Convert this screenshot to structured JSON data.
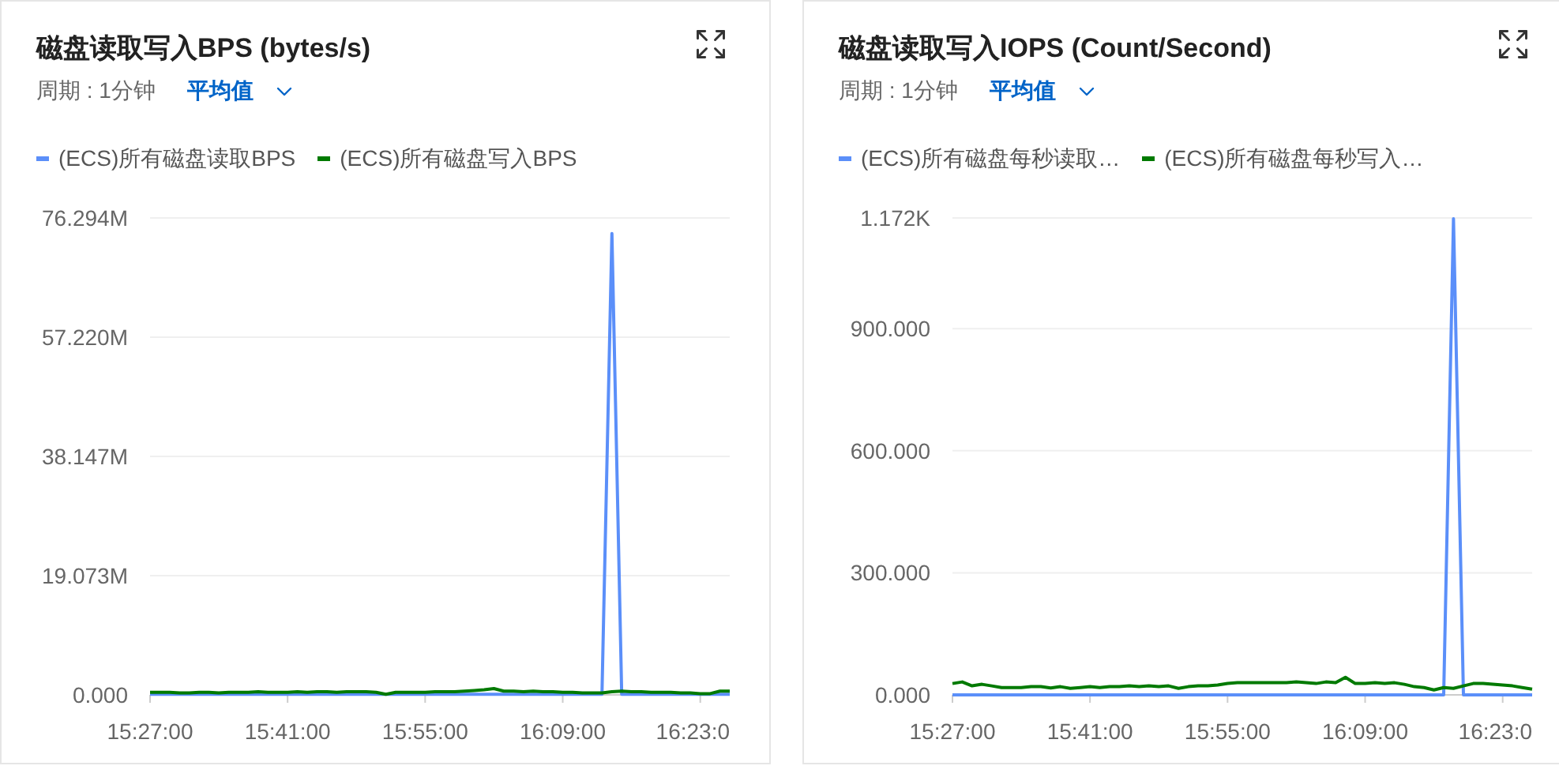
{
  "panels": [
    {
      "title": "磁盘读取写入BPS (bytes/s)",
      "period": "周期 : 1分钟",
      "aggregation": "平均值",
      "chart_data": {
        "type": "line",
        "categories": [
          "15:27:00",
          null,
          null,
          null,
          null,
          null,
          null,
          null,
          null,
          null,
          null,
          null,
          null,
          null,
          "15:41:00",
          null,
          null,
          null,
          null,
          null,
          null,
          null,
          null,
          null,
          null,
          null,
          null,
          null,
          "15:55:00",
          null,
          null,
          null,
          null,
          null,
          null,
          null,
          null,
          null,
          null,
          null,
          null,
          null,
          "16:09:00",
          null,
          null,
          null,
          null,
          null,
          null,
          null,
          null,
          null,
          null,
          null,
          null,
          null,
          "16:23:0",
          null,
          null,
          null
        ],
        "series": [
          {
            "name": "(ECS)所有磁盘读取BPS",
            "color": "#5b8ff9",
            "values": [
              0.1,
              0.1,
              0.1,
              0.1,
              0.1,
              0.1,
              0.1,
              0.1,
              0.1,
              0.1,
              0.1,
              0.1,
              0.1,
              0.1,
              0.1,
              0.1,
              0.1,
              0.1,
              0.1,
              0.1,
              0.1,
              0.1,
              0.1,
              0.1,
              0.1,
              0.1,
              0.1,
              0.1,
              0.1,
              0.1,
              0.1,
              0.1,
              0.1,
              0.1,
              0.1,
              0.1,
              0.1,
              0.1,
              0.1,
              0.1,
              0.1,
              0.1,
              0.1,
              0.1,
              0.1,
              0.1,
              0.1,
              73.8,
              0.1,
              0.1,
              0.1,
              0.1,
              0.1,
              0.1,
              0.1,
              0.1,
              0.1,
              0.1,
              0.1,
              0.1
            ]
          },
          {
            "name": "(ECS)所有磁盘写入BPS",
            "color": "#007a00",
            "values": [
              0.4,
              0.4,
              0.4,
              0.3,
              0.3,
              0.4,
              0.4,
              0.3,
              0.4,
              0.4,
              0.4,
              0.5,
              0.4,
              0.4,
              0.4,
              0.5,
              0.4,
              0.5,
              0.5,
              0.4,
              0.5,
              0.5,
              0.5,
              0.4,
              0.1,
              0.4,
              0.4,
              0.4,
              0.4,
              0.5,
              0.5,
              0.5,
              0.6,
              0.7,
              0.8,
              1.0,
              0.6,
              0.6,
              0.5,
              0.6,
              0.5,
              0.5,
              0.4,
              0.4,
              0.3,
              0.3,
              0.3,
              0.5,
              0.6,
              0.5,
              0.5,
              0.4,
              0.4,
              0.4,
              0.3,
              0.3,
              0.2,
              0.2,
              0.6,
              0.6
            ]
          }
        ],
        "ylim": [
          0,
          76.294
        ],
        "grid": true,
        "yticks": [
          {
            "value": 0,
            "label": "0.000"
          },
          {
            "value": 19.073,
            "label": "19.073M"
          },
          {
            "value": 38.147,
            "label": "38.147M"
          },
          {
            "value": 57.22,
            "label": "57.220M"
          },
          {
            "value": 76.294,
            "label": "76.294M"
          }
        ]
      }
    },
    {
      "title": "磁盘读取写入IOPS (Count/Second)",
      "period": "周期 : 1分钟",
      "aggregation": "平均值",
      "chart_data": {
        "type": "line",
        "categories": [
          "15:27:00",
          null,
          null,
          null,
          null,
          null,
          null,
          null,
          null,
          null,
          null,
          null,
          null,
          null,
          "15:41:00",
          null,
          null,
          null,
          null,
          null,
          null,
          null,
          null,
          null,
          null,
          null,
          null,
          null,
          "15:55:00",
          null,
          null,
          null,
          null,
          null,
          null,
          null,
          null,
          null,
          null,
          null,
          null,
          null,
          "16:09:00",
          null,
          null,
          null,
          null,
          null,
          null,
          null,
          null,
          null,
          null,
          null,
          null,
          null,
          "16:23:0",
          null,
          null,
          null
        ],
        "series": [
          {
            "name": "(ECS)所有磁盘每秒读取…",
            "color": "#5b8ff9",
            "values": [
              0,
              0,
              0,
              0,
              0,
              0,
              0,
              0,
              0,
              0,
              0,
              0,
              0,
              0,
              0,
              0,
              0,
              0,
              0,
              0,
              0,
              0,
              0,
              0,
              0,
              0,
              0,
              0,
              0,
              0,
              0,
              0,
              0,
              0,
              0,
              0,
              0,
              0,
              0,
              0,
              0,
              0,
              0,
              0,
              0,
              0,
              0,
              0,
              0,
              0,
              0,
              1170,
              0,
              0,
              0,
              0,
              0,
              0,
              0,
              0
            ]
          },
          {
            "name": "(ECS)所有磁盘每秒写入…",
            "color": "#007a00",
            "values": [
              28,
              32,
              22,
              26,
              22,
              18,
              18,
              18,
              20,
              20,
              17,
              20,
              16,
              18,
              20,
              18,
              20,
              20,
              22,
              20,
              22,
              20,
              22,
              16,
              20,
              22,
              22,
              24,
              28,
              30,
              30,
              30,
              30,
              30,
              30,
              32,
              30,
              28,
              32,
              30,
              43,
              28,
              28,
              30,
              28,
              30,
              26,
              20,
              18,
              12,
              18,
              16,
              22,
              28,
              28,
              26,
              24,
              22,
              18,
              14
            ]
          }
        ],
        "ylim": [
          0,
          1172
        ],
        "grid": true,
        "yticks": [
          {
            "value": 0,
            "label": "0.000"
          },
          {
            "value": 300,
            "label": "300.000"
          },
          {
            "value": 600,
            "label": "600.000"
          },
          {
            "value": 900,
            "label": "900.000"
          },
          {
            "value": 1172,
            "label": "1.172K"
          }
        ]
      }
    }
  ]
}
